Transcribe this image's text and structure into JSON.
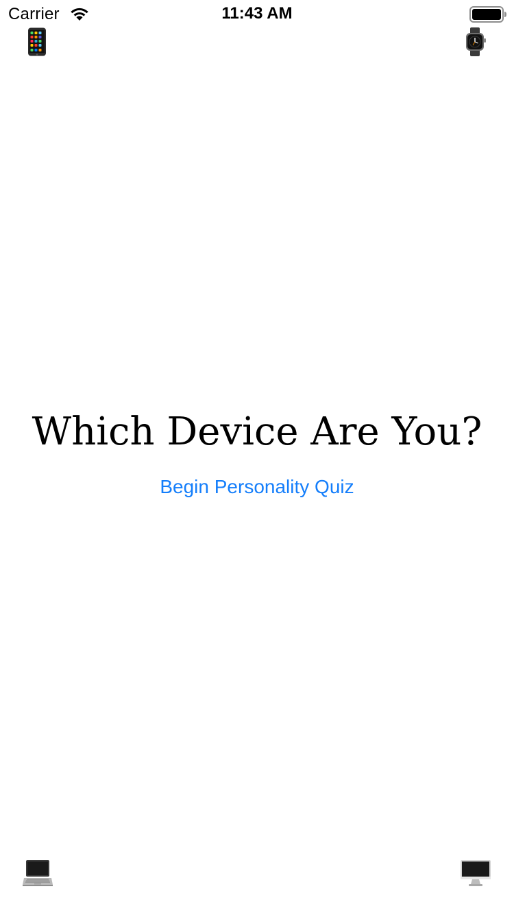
{
  "status_bar": {
    "carrier": "Carrier",
    "time": "11:43 AM",
    "wifi_icon": "wifi-icon",
    "battery_icon": "battery-full-icon"
  },
  "corner_icons": {
    "top_left": "mobile-phone-icon",
    "top_right": "watch-icon",
    "bottom_left": "laptop-icon",
    "bottom_right": "desktop-computer-icon"
  },
  "main": {
    "title": "Which Device Are You?",
    "begin_button_label": "Begin Personality Quiz"
  },
  "colors": {
    "accent": "#147efb",
    "text": "#000000",
    "background": "#ffffff"
  }
}
